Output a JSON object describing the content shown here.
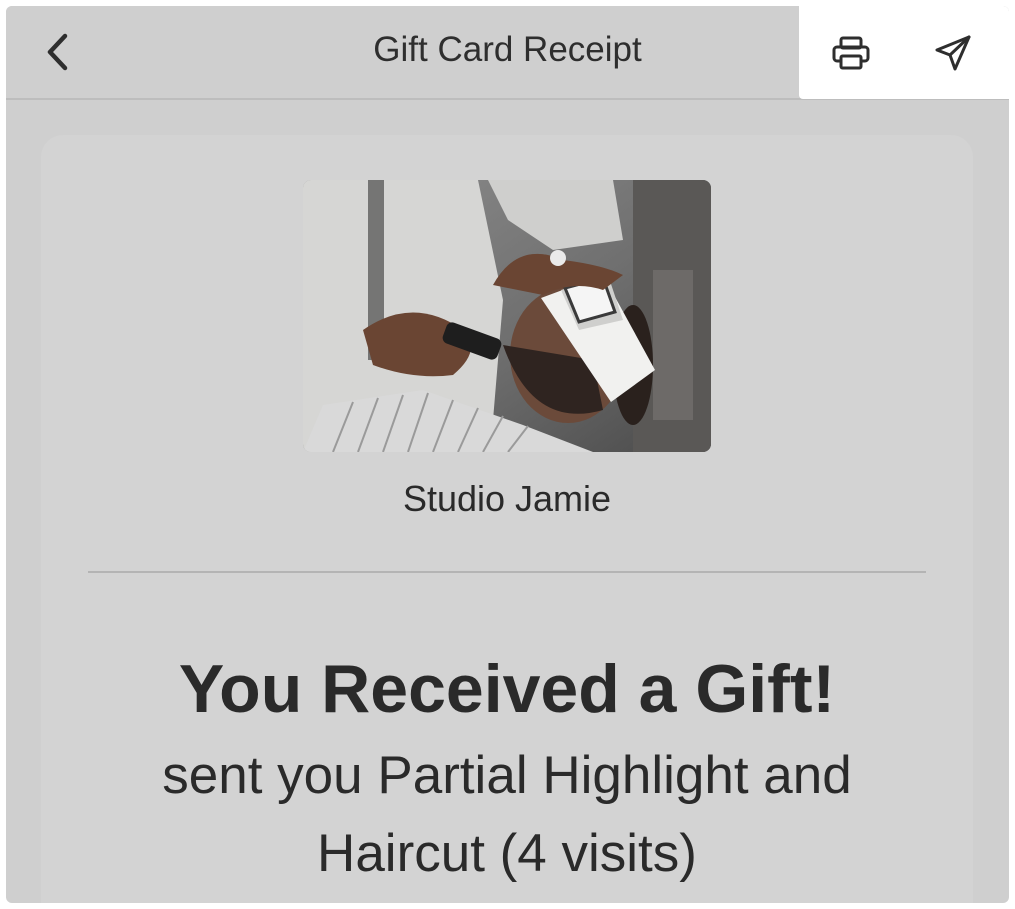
{
  "header": {
    "title": "Gift Card Receipt",
    "back_icon": "chevron-left-icon",
    "print_icon": "printer-icon",
    "send_icon": "paper-plane-icon"
  },
  "card": {
    "image_alt": "barber-shop-photo",
    "business_name": "Studio Jamie",
    "headline": "You Received a Gift!",
    "subline": "sent you Partial Highlight and Haircut (4 visits)"
  },
  "colors": {
    "page_overlay": "#cfcfcf",
    "card_bg": "#d3d3d3",
    "actions_bg": "#ffffff",
    "text": "#2b2b2b"
  }
}
